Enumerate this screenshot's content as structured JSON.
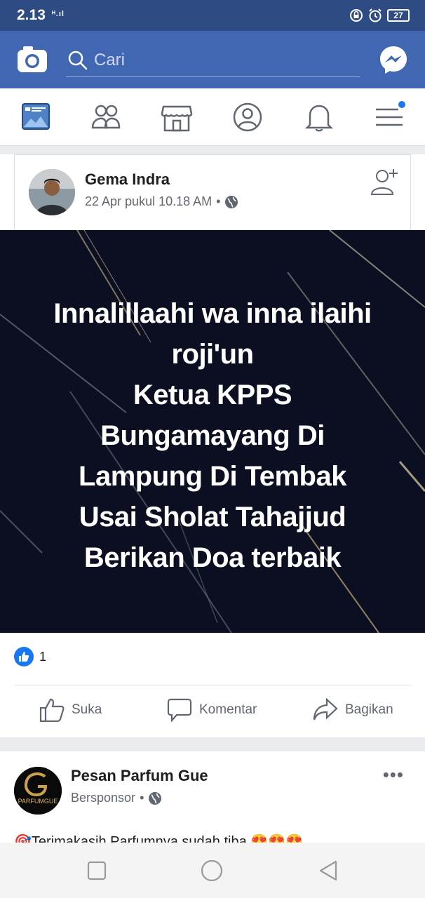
{
  "status": {
    "time": "2.13",
    "signal": "ᴴ.ıl",
    "battery": "27"
  },
  "search": {
    "placeholder": "Cari"
  },
  "nav": {
    "items": [
      "feed-icon",
      "friends-icon",
      "marketplace-icon",
      "profile-icon",
      "notifications-icon",
      "menu-icon"
    ],
    "notification_dot_color": "#1877f2"
  },
  "post": {
    "author": "Gema Indra",
    "timestamp": "22 Apr pukul 10.18 AM",
    "separator": "•",
    "image_text": "Innalillaahi wa inna ilaihi\nroji'un\nKetua KPPS\nBungamayang Di\nLampung Di Tembak\nUsai Sholat Tahajjud\nBerikan Doa terbaik",
    "reaction_count": "1",
    "actions": {
      "like": "Suka",
      "comment": "Komentar",
      "share": "Bagikan"
    }
  },
  "ad": {
    "name": "Pesan Parfum Gue",
    "label": "Bersponsor",
    "separator": "•",
    "logo_text": "PARFUMGUE",
    "text": "🎯Terimakasih Parfumnya sudah tiba 😍😍😍"
  },
  "colors": {
    "status_bar": "#2f4b84",
    "top_bar": "#4267b2",
    "accent": "#1877f2",
    "post_bg": "#0b0f21"
  }
}
